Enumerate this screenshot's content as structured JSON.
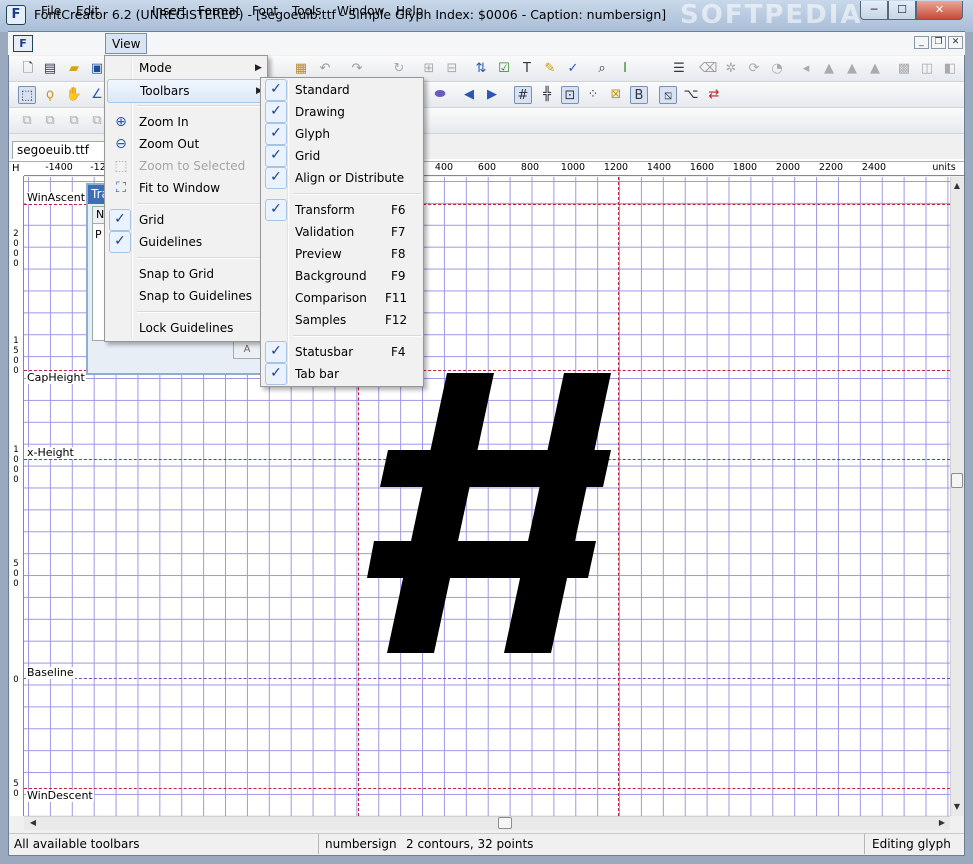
{
  "window": {
    "title": "FontCreator 6.2 (UNREGISTERED) - [segoeuib.ttf - Simple Glyph Index: $0006 - Caption: numbersign]",
    "watermark": "SOFTPEDIA",
    "app_icon_text": "F",
    "controls": {
      "minimize": "─",
      "maximize": "☐",
      "close": "✕"
    }
  },
  "menubar": {
    "items": [
      "File",
      "Edit",
      "View",
      "Insert",
      "Format",
      "Font",
      "Tools",
      "Window",
      "Help"
    ],
    "active": "View",
    "mdi_controls": {
      "minimize": "_",
      "restore": "❐",
      "close": "✕"
    }
  },
  "view_menu": {
    "items": [
      {
        "label": "Mode",
        "has_submenu": true
      },
      {
        "label": "Toolbars",
        "has_submenu": true,
        "highlighted": true
      },
      {
        "label": "Zoom In",
        "icon": "zoom-in-icon"
      },
      {
        "label": "Zoom Out",
        "icon": "zoom-out-icon"
      },
      {
        "label": "Zoom to Selected",
        "icon": "zoom-selected-icon",
        "disabled": true
      },
      {
        "label": "Fit to Window",
        "icon": "fit-window-icon"
      },
      {
        "label": "Grid",
        "checked": true
      },
      {
        "label": "Guidelines",
        "checked": true
      },
      {
        "label": "Snap to Grid"
      },
      {
        "label": "Snap to Guidelines"
      },
      {
        "label": "Lock Guidelines"
      }
    ]
  },
  "toolbars_menu": {
    "items": [
      {
        "label": "Standard",
        "checked": true,
        "shortcut": ""
      },
      {
        "label": "Drawing",
        "checked": true,
        "shortcut": ""
      },
      {
        "label": "Glyph",
        "checked": true,
        "shortcut": ""
      },
      {
        "label": "Grid",
        "checked": true,
        "shortcut": ""
      },
      {
        "label": "Align or Distribute",
        "checked": true,
        "shortcut": ""
      },
      {
        "label": "Transform",
        "checked": true,
        "shortcut": "F6"
      },
      {
        "label": "Validation",
        "checked": false,
        "shortcut": "F7"
      },
      {
        "label": "Preview",
        "checked": false,
        "shortcut": "F8"
      },
      {
        "label": "Background",
        "checked": false,
        "shortcut": "F9"
      },
      {
        "label": "Comparison",
        "checked": false,
        "shortcut": "F11"
      },
      {
        "label": "Samples",
        "checked": false,
        "shortcut": "F12"
      },
      {
        "label": "Statusbar",
        "checked": true,
        "shortcut": "F4"
      },
      {
        "label": "Tab bar",
        "checked": true,
        "shortcut": ""
      }
    ]
  },
  "font_tab": "segoeuib.ttf",
  "ruler": {
    "corner": "H",
    "h_labels": [
      "-1400",
      "-12",
      "400",
      "600",
      "800",
      "1000",
      "1200",
      "1400",
      "1600",
      "1800",
      "2000",
      "2200",
      "2400",
      "units"
    ],
    "v_labels": [
      [
        "2",
        "0",
        "0",
        "0"
      ],
      [
        "1",
        "5",
        "0",
        "0"
      ],
      [
        "1",
        "0",
        "0",
        "0"
      ],
      [
        "5",
        "0",
        "0"
      ],
      [
        "0"
      ],
      [
        "5",
        "0"
      ]
    ]
  },
  "metrics": {
    "win_ascent": "WinAscent",
    "cap_height": "CapHeight",
    "x_height": "x-Height",
    "baseline": "Baseline",
    "win_descent": "WinDescent"
  },
  "glyph": {
    "caption": "numbersign",
    "character": "#"
  },
  "transform_panel": {
    "title": "Tra",
    "column": "N",
    "row": "P",
    "button": "A"
  },
  "statusbar": {
    "hint": "All available toolbars",
    "glyph_name": "numbersign",
    "info": "2 contours, 32 points",
    "mode": "Editing glyph"
  },
  "toolbar_icons": {
    "row1": [
      "new-icon",
      "open-font-icon",
      "open-folder-icon",
      "save-icon",
      "cut-icon",
      "copy-icon",
      "paste-icon",
      "undo-icon",
      "redo-icon",
      "refresh-icon",
      "import-icon",
      "export-icon",
      "sort-icon",
      "validate-icon",
      "text-icon",
      "brush-icon",
      "check-icon",
      "zoom-icon",
      "glyph-insert-icon",
      "list-icon",
      "eraser-icon",
      "scatter-icon",
      "rotate-icon",
      "shape-icon",
      "align-left-icon",
      "align-center-icon",
      "align-right-icon",
      "align-top-icon",
      "combine-icon",
      "intersect-icon",
      "exclude-icon"
    ],
    "row2": [
      "select-icon",
      "lasso-icon",
      "hand-icon",
      "measure-icon",
      "ellipse-icon",
      "prev-icon",
      "next-icon",
      "grid-icon",
      "grid-cross-icon",
      "grid-snap-icon",
      "grid-points-icon",
      "grid-lock-icon",
      "grid-bounds-icon",
      "metrics-icon",
      "tree-icon",
      "compare-icon"
    ],
    "row3": [
      "align-a-icon",
      "align-b-icon",
      "align-c-icon",
      "align-d-icon"
    ]
  }
}
